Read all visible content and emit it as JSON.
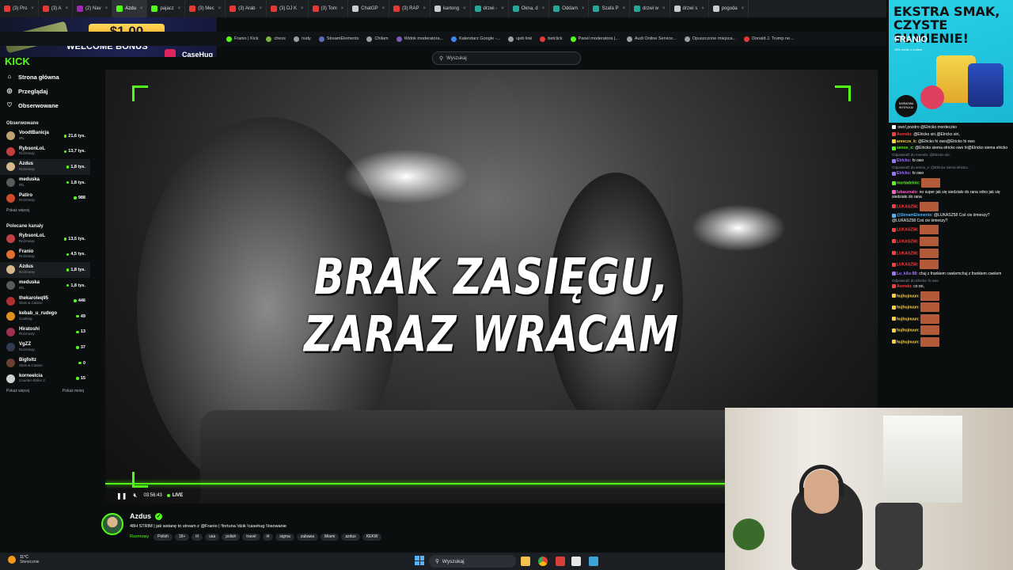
{
  "browser": {
    "tabs": [
      {
        "label": "(3) Pro",
        "color": "#e53935"
      },
      {
        "label": "(3) A",
        "color": "#e53935"
      },
      {
        "label": "(2) Nav",
        "color": "#9c27b0"
      },
      {
        "label": "Azdu",
        "color": "#53fc18",
        "active": true
      },
      {
        "label": "pajacz",
        "color": "#53fc18"
      },
      {
        "label": "(3) Mec",
        "color": "#e53935"
      },
      {
        "label": "(3) Arab",
        "color": "#e53935"
      },
      {
        "label": "(3) DJ K",
        "color": "#e53935"
      },
      {
        "label": "(3) Tom",
        "color": "#e53935"
      },
      {
        "label": "ChatGP",
        "color": "#cccccc"
      },
      {
        "label": "(3) RAP",
        "color": "#e53935"
      },
      {
        "label": "kartong",
        "color": "#cccccc"
      },
      {
        "label": "drzwi -",
        "color": "#26a69a"
      },
      {
        "label": "Okna, d",
        "color": "#26a69a"
      },
      {
        "label": "Oddam",
        "color": "#26a69a"
      },
      {
        "label": "Szafa P",
        "color": "#26a69a"
      },
      {
        "label": "drzwi w",
        "color": "#26a69a"
      },
      {
        "label": "drzwi s",
        "color": "#cccccc"
      },
      {
        "label": "pogoda",
        "color": "#cccccc"
      }
    ],
    "bookmarks": [
      {
        "label": "Franio | Kick",
        "color": "#53fc18"
      },
      {
        "label": "chess",
        "color": "#7cb342"
      },
      {
        "label": "nudy",
        "color": "#9e9e9e"
      },
      {
        "label": "StreamElements",
        "color": "#5c6bc0"
      },
      {
        "label": "Chilam",
        "color": "#9e9e9e"
      },
      {
        "label": "Widok moderatora...",
        "color": "#7e57c2"
      },
      {
        "label": "Kalendarz Google -...",
        "color": "#4285f4"
      },
      {
        "label": "ujeb link",
        "color": "#9e9e9e"
      },
      {
        "label": "betclick",
        "color": "#e53935"
      },
      {
        "label": "Panel moderatora |...",
        "color": "#53fc18"
      },
      {
        "label": "Audi Online Service...",
        "color": "#9e9e9e"
      },
      {
        "label": "Opuszczone miejsca...",
        "color": "#9e9e9e"
      },
      {
        "label": "Donald J. Trump ne...",
        "color": "#e53935"
      }
    ]
  },
  "casino_ad": {
    "amount": "$1.00",
    "bonus": "WELCOME BONUS",
    "brand": "CaseHug"
  },
  "kick_logo": "KICK",
  "sidebar": {
    "nav": [
      {
        "label": "Strona główna",
        "icon": "home-icon",
        "glyph": "⌂"
      },
      {
        "label": "Przeglądaj",
        "icon": "browse-icon",
        "glyph": "◎"
      },
      {
        "label": "Obserwowane",
        "icon": "heart-icon",
        "glyph": "♡"
      }
    ],
    "followed_title": "Obserwowane",
    "followed": [
      {
        "name": "VoodtBanicja",
        "category": "IRL",
        "viewers": "21,6 tys.",
        "color": "#c0a070"
      },
      {
        "name": "RybsonLoL",
        "category": "Rozmowy",
        "viewers": "13,7 tys.",
        "color": "#c04040"
      },
      {
        "name": "Azdus",
        "category": "Rozmowy",
        "viewers": "1,8 tys.",
        "color": "#d9b78c",
        "selected": true
      },
      {
        "name": "meduska",
        "category": "IRL",
        "viewers": "1,8 tys.",
        "color": "#5a5a5a"
      },
      {
        "name": "Patiro",
        "category": "Rozmowy",
        "viewers": "988",
        "color": "#d04a2a"
      }
    ],
    "followed_more": "Pokaż więcej",
    "recommended_title": "Polecane kanały",
    "recommended": [
      {
        "name": "RybsonLoL",
        "category": "Rozmowy",
        "viewers": "13,5 tys.",
        "color": "#c04040"
      },
      {
        "name": "Franio",
        "category": "Rozmowy",
        "viewers": "4,5 tys.",
        "color": "#e07030"
      },
      {
        "name": "Azdus",
        "category": "Rozmowy",
        "viewers": "1,8 tys.",
        "color": "#d9b78c",
        "selected": true
      },
      {
        "name": "meduska",
        "category": "IRL",
        "viewers": "1,8 tys.",
        "color": "#5a5a5a"
      },
      {
        "name": "thekaroleq95",
        "category": "Slots & Casino",
        "viewers": "446",
        "color": "#b03030"
      },
      {
        "name": "kebab_u_rudego",
        "category": "Cooking",
        "viewers": "49",
        "color": "#e09020"
      },
      {
        "name": "Hiratoshi",
        "category": "Rozmowy",
        "viewers": "13",
        "color": "#a03050"
      },
      {
        "name": "VgZZ",
        "category": "Rozmowy",
        "viewers": "37",
        "color": "#303a50"
      },
      {
        "name": "Bigfoltz",
        "category": "Slots & Casino",
        "viewers": "0",
        "color": "#6a4030"
      },
      {
        "name": "korneelcia",
        "category": "Counter-Strike 2",
        "viewers": "15",
        "color": "#d0d0d0"
      }
    ],
    "more_label": "Pokaż więcej",
    "less_label": "Pokaż mniej"
  },
  "search": {
    "placeholder": "Wyszukaj"
  },
  "player": {
    "overlay_text": "BRAK ZASIĘGU, ZARAZ WRACAM",
    "time": "03:56:43",
    "live_label": "LIVE",
    "progress": 1.0
  },
  "stream": {
    "streamer": "Azdus",
    "title": "48H STRIM | jak wstanę to stream z @Franio | !fortuna !dzik !casehug !losowanie",
    "category": "Rozmowy",
    "tags": [
      "Polish",
      "18+",
      "irl",
      "usa",
      "polish",
      "travel",
      "irl",
      "sigma",
      "zabawa",
      "Miami",
      "azdus",
      "KEKW"
    ]
  },
  "franio_ad": {
    "headline": "EKSTRA SMAK,\nCZYSTE SUMIENIE!",
    "brand": "FRANIO",
    "sub": "10% zniżki z kodem",
    "badge": "DARMOWA WYSYŁKA!"
  },
  "chat": [
    {
      "user": "",
      "text": "owo!,pozdro @Elricko mordeczko",
      "color": "#ffffff"
    },
    {
      "user": "Avendo:",
      "text": "@Elricko siri,@Elricko siri,",
      "color": "#ff3b3b"
    },
    {
      "user": "areecze_k:",
      "text": "@Elricko hi owo@Elricko hi owo",
      "color": "#ffcf3b"
    },
    {
      "user": "senox_x:",
      "text": "@Elricko siema elricko owo hi@Elricko siema elricko",
      "color": "#53fc18"
    },
    {
      "reply": "Odpowiedź do Avendo: @Elricko siri,"
    },
    {
      "user": "Elricko:",
      "text": "hi owo",
      "color": "#a070ff"
    },
    {
      "reply": "Odpowiedź do senox_x: @Elricko siema elricko..."
    },
    {
      "user": "Elricko:",
      "text": "hi owo",
      "color": "#a070ff"
    },
    {
      "user": "mortadeinic:",
      "text": "",
      "color": "#53fc18"
    },
    {
      "user": "lukasznalo:",
      "text": "no super jak się siedziało do rana xdno jak się siedziało do rana",
      "color": "#ff60c0"
    },
    {
      "user": "LUKASZ58:",
      "text": "",
      "color": "#ff3b3b"
    },
    {
      "user": "@StreamElements:",
      "text": "@LUKASZ58 Coś cie śmieszy?@LUKASZ58 Coś cie śmieszy?",
      "color": "#4fb3ff"
    },
    {
      "user": "LUKASZ58:",
      "text": "",
      "color": "#ff3b3b"
    },
    {
      "user": "LUKASZ58:",
      "text": "",
      "color": "#ff3b3b"
    },
    {
      "user": "LUKASZ58:",
      "text": "",
      "color": "#ff3b3b"
    },
    {
      "user": "LUKASZ58:",
      "text": "",
      "color": "#ff3b3b"
    },
    {
      "user": "Lu_kAs:88:",
      "text": "chuj z frankiem cwelemchuj z frankiem cwelem",
      "color": "#a070ff"
    },
    {
      "reply": "Odpowiedź do Elricko: hi owo"
    },
    {
      "user": "Avendo:",
      "text": "co roi,",
      "color": "#ff3b3b"
    },
    {
      "user": "hujhujnuun:",
      "text": "",
      "color": "#ffcf3b"
    },
    {
      "user": "hujhujnuun:",
      "text": "",
      "color": "#ffcf3b"
    },
    {
      "user": "hujhujnuun:",
      "text": "",
      "color": "#ffcf3b"
    },
    {
      "user": "hujhujnuun:",
      "text": "",
      "color": "#ffcf3b"
    },
    {
      "user": "hujhujnuun:",
      "text": "",
      "color": "#ffcf3b"
    }
  ],
  "taskbar": {
    "temp": "11°C",
    "condition": "Słonecznie",
    "search": "Wyszukaj"
  },
  "colors": {
    "accent": "#53fc18",
    "bg": "#0b0e0f"
  }
}
